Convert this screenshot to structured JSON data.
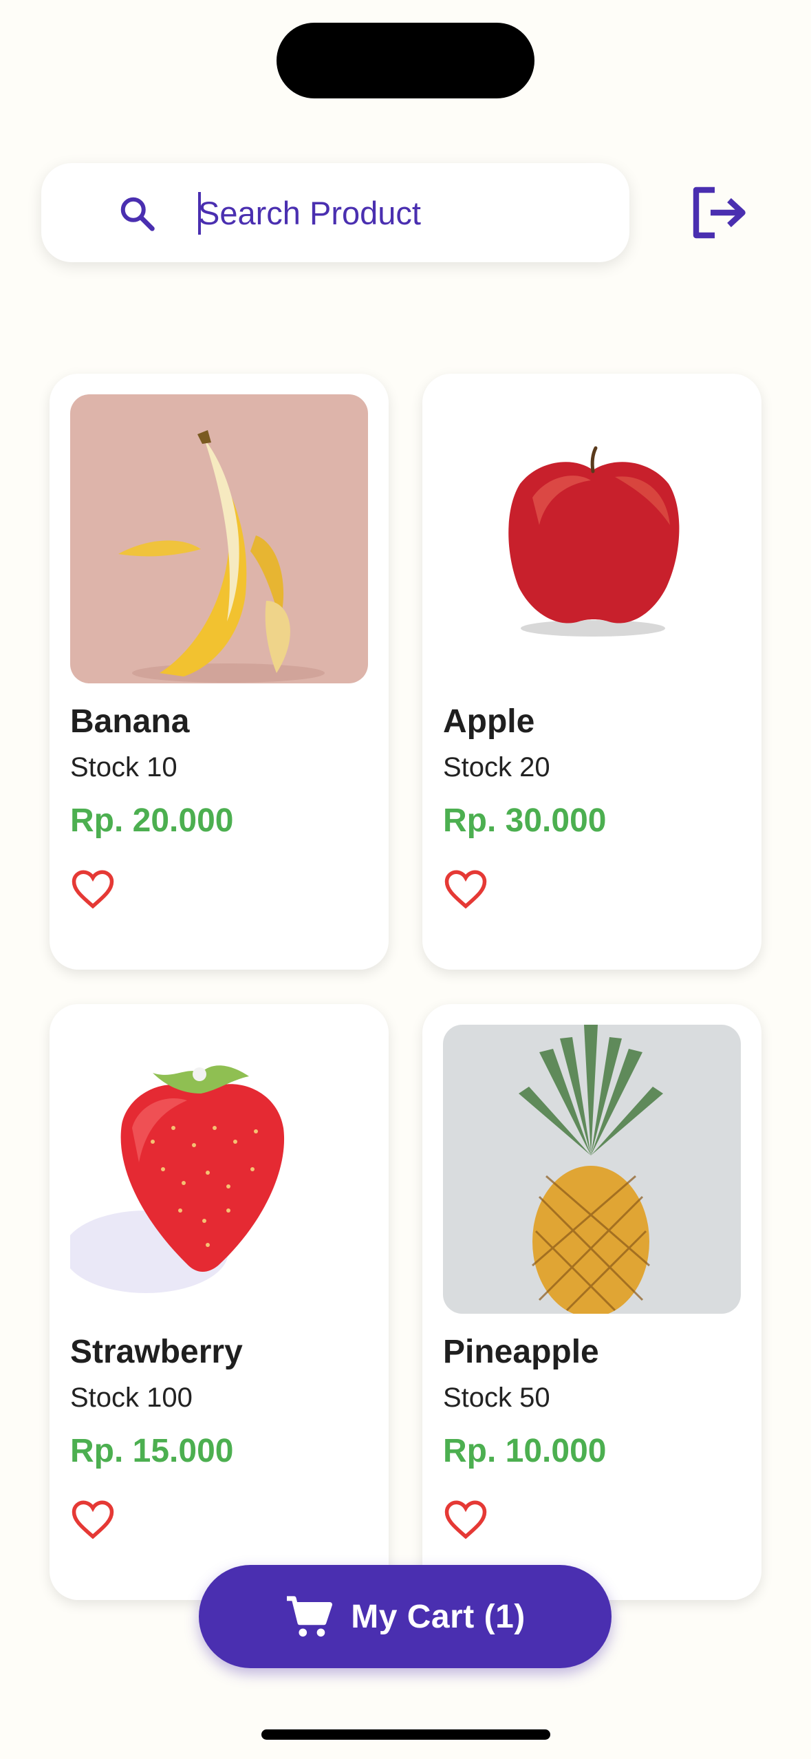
{
  "search": {
    "placeholder": "Search Product"
  },
  "products": [
    {
      "name": "Banana",
      "stock": "Stock 10",
      "price": "Rp. 20.000",
      "image": "banana"
    },
    {
      "name": "Apple",
      "stock": "Stock 20",
      "price": "Rp. 30.000",
      "image": "apple"
    },
    {
      "name": "Strawberry",
      "stock": "Stock 100",
      "price": "Rp. 15.000",
      "image": "strawberry"
    },
    {
      "name": "Pineapple",
      "stock": "Stock 50",
      "price": "Rp. 10.000",
      "image": "pineapple"
    }
  ],
  "cart": {
    "label": "My Cart (1)"
  },
  "colors": {
    "accent": "#4a2fb0",
    "price": "#4caf50",
    "favorite": "#e53935",
    "background": "#fefdf8"
  },
  "icons": [
    "search-icon",
    "logout-icon",
    "heart-outline-icon",
    "cart-icon"
  ]
}
